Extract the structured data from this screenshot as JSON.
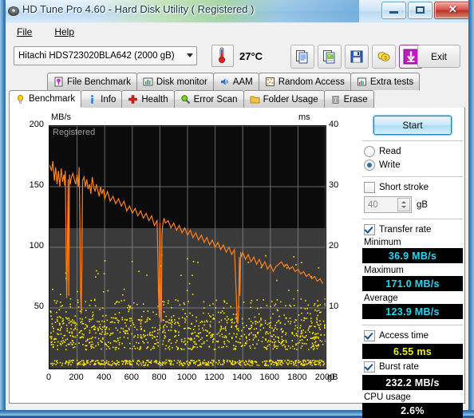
{
  "window": {
    "title": "HD Tune Pro 4.60 - Hard Disk Utility (  Registered )",
    "minimize_label": "–",
    "maximize_label": "□",
    "close_label": "✕"
  },
  "menu": {
    "items": [
      {
        "label": "File"
      },
      {
        "label": "Help"
      }
    ]
  },
  "toolbar": {
    "drive": "Hitachi HDS723020BLA642 (2000 gB)",
    "temperature": "27°C",
    "icons": [
      {
        "name": "copy-text-icon"
      },
      {
        "name": "copy-image-icon"
      },
      {
        "name": "save-icon"
      },
      {
        "name": "support-icon"
      },
      {
        "name": "download-icon"
      }
    ],
    "exit_label": "Exit"
  },
  "tabs": {
    "row1": [
      {
        "label": "File Benchmark",
        "icon": "file-benchmark-icon",
        "active": false
      },
      {
        "label": "Disk monitor",
        "icon": "disk-monitor-icon",
        "active": false
      },
      {
        "label": "AAM",
        "icon": "aam-icon",
        "active": false
      },
      {
        "label": "Random Access",
        "icon": "random-access-icon",
        "active": false
      },
      {
        "label": "Extra tests",
        "icon": "extra-tests-icon",
        "active": false
      }
    ],
    "row2": [
      {
        "label": "Benchmark",
        "icon": "benchmark-icon",
        "active": true
      },
      {
        "label": "Info",
        "icon": "info-icon",
        "active": false
      },
      {
        "label": "Health",
        "icon": "health-icon",
        "active": false
      },
      {
        "label": "Error Scan",
        "icon": "error-scan-icon",
        "active": false
      },
      {
        "label": "Folder Usage",
        "icon": "folder-usage-icon",
        "active": false
      },
      {
        "label": "Erase",
        "icon": "erase-icon",
        "active": false
      }
    ]
  },
  "controls": {
    "start_label": "Start",
    "read_label": "Read",
    "write_label": "Write",
    "read_selected": false,
    "write_selected": true,
    "short_stroke_label": "Short stroke",
    "short_stroke_checked": false,
    "short_stroke_value": "40",
    "short_stroke_unit": "gB",
    "transfer_rate_label": "Transfer rate",
    "transfer_rate_checked": true,
    "minimum_label": "Minimum",
    "minimum_value": "36.9 MB/s",
    "maximum_label": "Maximum",
    "maximum_value": "171.0 MB/s",
    "average_label": "Average",
    "average_value": "123.9 MB/s",
    "access_time_label": "Access time",
    "access_time_checked": true,
    "access_time_value": "6.55 ms",
    "burst_rate_label": "Burst rate",
    "burst_rate_checked": true,
    "burst_rate_value": "232.2 MB/s",
    "cpu_usage_label": "CPU usage",
    "cpu_usage_value": "2.6%"
  },
  "chart_data": {
    "type": "line",
    "title": "",
    "watermark": "Registered",
    "ylabel": "MB/s",
    "ylabel_right": "ms",
    "xlabel": "gB",
    "xlim": [
      0,
      2000
    ],
    "ylim": [
      0,
      200
    ],
    "ylim_right": [
      0,
      40
    ],
    "xticks": [
      0,
      200,
      400,
      600,
      800,
      1000,
      1200,
      1400,
      1600,
      1800,
      2000
    ],
    "yticks": [
      50,
      100,
      150,
      200
    ],
    "yticks_right": [
      10,
      20,
      30,
      40
    ],
    "grid": true,
    "plot_bg": "#3a3a3a",
    "legend_position": "none",
    "series": [
      {
        "name": "Transfer rate",
        "color": "#ff7f1a",
        "axis": "left",
        "units": "MB/s",
        "x": [
          0,
          15,
          25,
          35,
          45,
          55,
          65,
          75,
          85,
          95,
          105,
          110,
          115,
          120,
          125,
          130,
          135,
          140,
          145,
          150,
          160,
          170,
          180,
          190,
          200,
          210,
          215,
          220,
          225,
          230,
          235,
          240,
          250,
          260,
          270,
          280,
          290,
          300,
          310,
          320,
          330,
          340,
          350,
          360,
          370,
          380,
          390,
          400,
          420,
          440,
          460,
          480,
          500,
          520,
          540,
          560,
          580,
          600,
          620,
          640,
          660,
          680,
          700,
          720,
          740,
          760,
          780,
          790,
          795,
          800,
          805,
          810,
          815,
          820,
          830,
          840,
          860,
          880,
          900,
          920,
          940,
          960,
          980,
          1000,
          1020,
          1040,
          1060,
          1080,
          1100,
          1120,
          1140,
          1160,
          1180,
          1200,
          1220,
          1240,
          1260,
          1280,
          1300,
          1320,
          1340,
          1355,
          1360,
          1365,
          1370,
          1375,
          1380,
          1385,
          1390,
          1400,
          1420,
          1440,
          1460,
          1480,
          1500,
          1520,
          1540,
          1560,
          1580,
          1600,
          1620,
          1640,
          1660,
          1680,
          1700,
          1720,
          1740,
          1760,
          1780,
          1800,
          1820,
          1840,
          1860,
          1880,
          1900,
          1920,
          1940,
          1960,
          1980,
          2000
        ],
        "y": [
          168,
          163,
          171,
          155,
          166,
          152,
          163,
          150,
          165,
          154,
          160,
          151,
          163,
          98,
          58,
          100,
          156,
          60,
          160,
          152,
          158,
          161,
          156,
          152,
          160,
          150,
          166,
          120,
          62,
          45,
          90,
          155,
          158,
          150,
          156,
          148,
          152,
          144,
          158,
          150,
          146,
          152,
          147,
          142,
          150,
          144,
          148,
          140,
          146,
          138,
          142,
          136,
          140,
          134,
          138,
          130,
          134,
          128,
          132,
          126,
          130,
          124,
          128,
          122,
          126,
          118,
          122,
          60,
          42,
          120,
          45,
          38,
          110,
          118,
          124,
          120,
          122,
          116,
          120,
          114,
          118,
          112,
          116,
          110,
          114,
          108,
          112,
          106,
          110,
          104,
          108,
          102,
          106,
          100,
          104,
          98,
          102,
          96,
          100,
          94,
          98,
          55,
          40,
          36.9,
          48,
          92,
          60,
          96,
          92,
          96,
          90,
          94,
          88,
          92,
          86,
          90,
          84,
          88,
          82,
          86,
          80,
          84,
          86,
          88,
          84,
          86,
          82,
          84,
          80,
          82,
          78,
          80,
          76,
          78,
          74,
          76,
          72,
          74,
          70
        ]
      },
      {
        "name": "Access time",
        "color": "#ffe600",
        "axis": "right",
        "units": "ms",
        "average": 6.55,
        "scatter": true,
        "note": "dense scatter of ~1500 points, most between 3 and 9 ms with a dense band near 1 ms at the baseline"
      }
    ]
  }
}
